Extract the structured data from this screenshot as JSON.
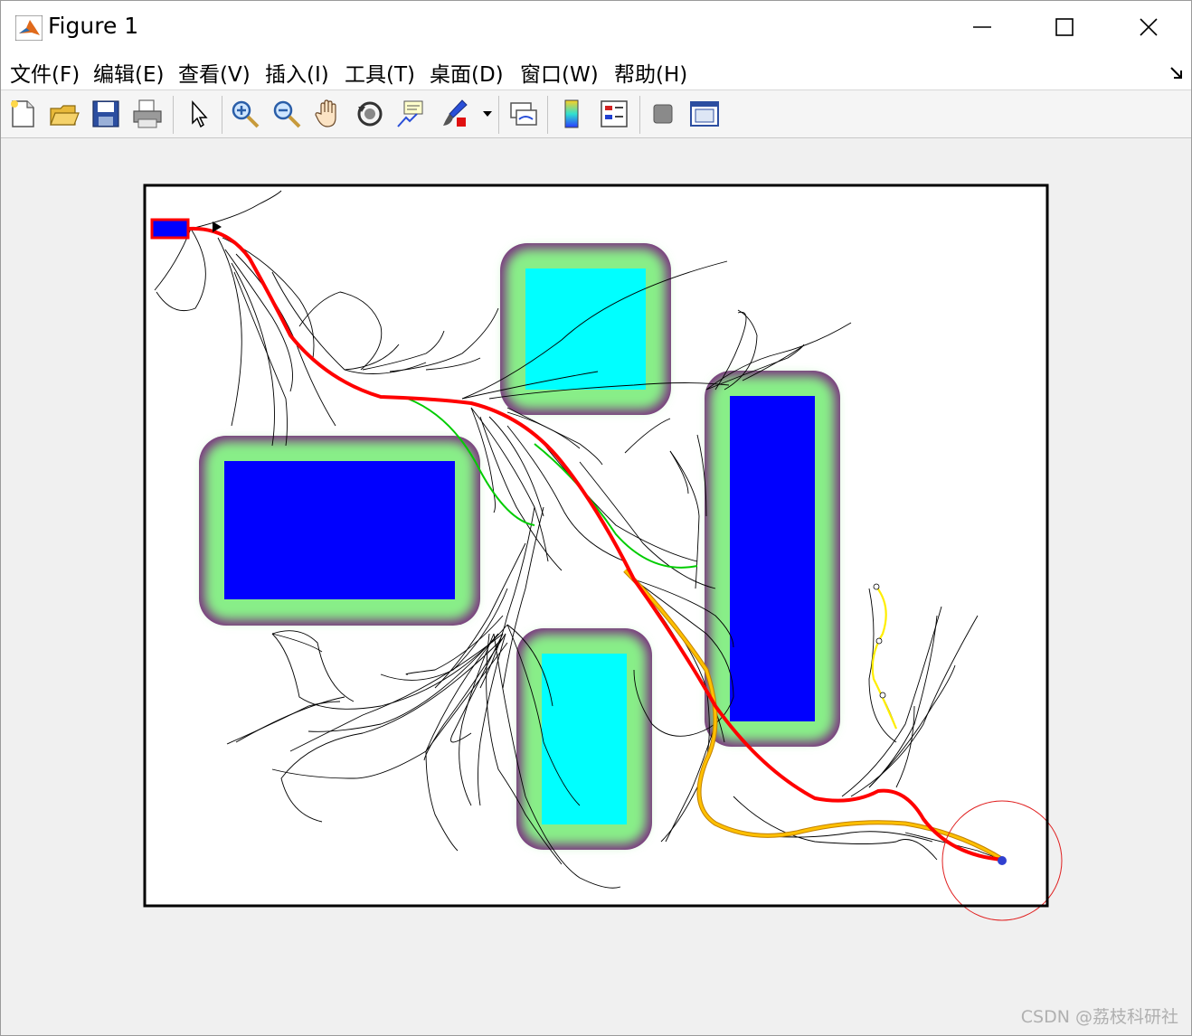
{
  "window": {
    "title": "Figure 1",
    "controls": [
      "minimize",
      "maximize",
      "close"
    ]
  },
  "menu": {
    "items": [
      "文件(F)",
      "编辑(E)",
      "查看(V)",
      "插入(I)",
      "工具(T)",
      "桌面(D)",
      "窗口(W)",
      "帮助(H)"
    ]
  },
  "toolbar": {
    "buttons": [
      "new-figure-icon",
      "open-file-icon",
      "save-icon",
      "print-icon",
      "select-arrow-icon",
      "zoom-in-icon",
      "zoom-out-icon",
      "pan-hand-icon",
      "rotate-3d-icon",
      "data-cursor-icon",
      "brush-icon",
      "link-plot-icon",
      "colorbar-icon",
      "legend-icon",
      "hide-plot-tools-icon",
      "show-plot-tools-icon"
    ]
  },
  "colors": {
    "obstacle_blue": "#0000ff",
    "obstacle_cyan": "#00ffff",
    "buffer_green": "#88ee88",
    "buffer_purple": "#7a2f7f",
    "final_path": "#ff0000",
    "candidate_path": "#ffb300",
    "green_branch": "#00cc00",
    "yellow_branch": "#ffff00",
    "tree_lines": "#000000",
    "goal_circle": "#e02020"
  },
  "watermark": "CSDN @荔枝科研社"
}
